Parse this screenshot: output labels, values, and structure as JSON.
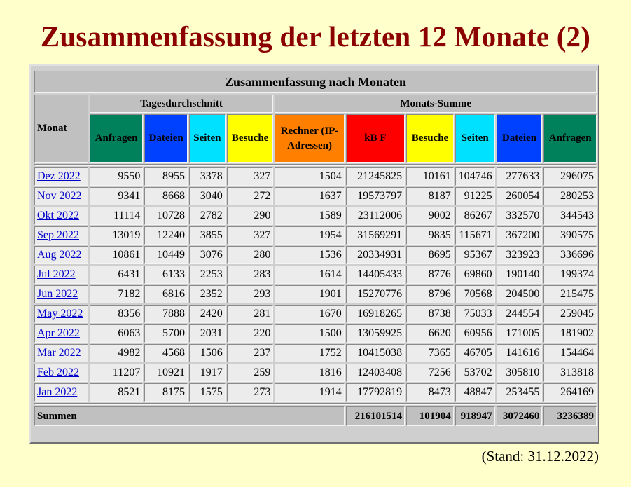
{
  "page_title": "Zusammenfassung der letzten 12 Monate (2)",
  "table": {
    "caption": "Zusammenfassung nach Monaten",
    "group_daily": "Tagesdurchschnitt",
    "group_monthly": "Monats-Summe",
    "month_header": "Monat",
    "daily_columns": [
      {
        "label": "Anfragen",
        "color": "#00805b"
      },
      {
        "label": "Dateien",
        "color": "#0040ff"
      },
      {
        "label": "Seiten",
        "color": "#00e0ff"
      },
      {
        "label": "Besuche",
        "color": "#ffff00"
      }
    ],
    "monthly_columns": [
      {
        "label": "Rechner (IP-Adressen)",
        "color": "#ff8000"
      },
      {
        "label": "kB F",
        "color": "#ff0000"
      },
      {
        "label": "Besuche",
        "color": "#ffff00"
      },
      {
        "label": "Seiten",
        "color": "#00e0ff"
      },
      {
        "label": "Dateien",
        "color": "#0040ff"
      },
      {
        "label": "Anfragen",
        "color": "#00805b"
      }
    ],
    "rows": [
      {
        "month": "Dez 2022",
        "values": [
          "9550",
          "8955",
          "3378",
          "327",
          "1504",
          "21245825",
          "10161",
          "104746",
          "277633",
          "296075"
        ]
      },
      {
        "month": "Nov 2022",
        "values": [
          "9341",
          "8668",
          "3040",
          "272",
          "1637",
          "19573797",
          "8187",
          "91225",
          "260054",
          "280253"
        ]
      },
      {
        "month": "Okt 2022",
        "values": [
          "11114",
          "10728",
          "2782",
          "290",
          "1589",
          "23112006",
          "9002",
          "86267",
          "332570",
          "344543"
        ]
      },
      {
        "month": "Sep 2022",
        "values": [
          "13019",
          "12240",
          "3855",
          "327",
          "1954",
          "31569291",
          "9835",
          "115671",
          "367200",
          "390575"
        ]
      },
      {
        "month": "Aug 2022",
        "values": [
          "10861",
          "10449",
          "3076",
          "280",
          "1536",
          "20334931",
          "8695",
          "95367",
          "323923",
          "336696"
        ]
      },
      {
        "month": "Jul 2022",
        "values": [
          "6431",
          "6133",
          "2253",
          "283",
          "1614",
          "14405433",
          "8776",
          "69860",
          "190140",
          "199374"
        ]
      },
      {
        "month": "Jun 2022",
        "values": [
          "7182",
          "6816",
          "2352",
          "293",
          "1901",
          "15270776",
          "8796",
          "70568",
          "204500",
          "215475"
        ]
      },
      {
        "month": "May 2022",
        "values": [
          "8356",
          "7888",
          "2420",
          "281",
          "1670",
          "16918265",
          "8738",
          "75033",
          "244554",
          "259045"
        ]
      },
      {
        "month": "Apr 2022",
        "values": [
          "6063",
          "5700",
          "2031",
          "220",
          "1500",
          "13059925",
          "6620",
          "60956",
          "171005",
          "181902"
        ]
      },
      {
        "month": "Mar 2022",
        "values": [
          "4982",
          "4568",
          "1506",
          "237",
          "1752",
          "10415038",
          "7365",
          "46705",
          "141616",
          "154464"
        ]
      },
      {
        "month": "Feb 2022",
        "values": [
          "11207",
          "10921",
          "1917",
          "259",
          "1816",
          "12403408",
          "7256",
          "53702",
          "305810",
          "313818"
        ]
      },
      {
        "month": "Jan 2022",
        "values": [
          "8521",
          "8175",
          "1575",
          "273",
          "1914",
          "17792819",
          "8473",
          "48847",
          "253455",
          "264169"
        ]
      }
    ],
    "totals": {
      "label": "Summen",
      "values": [
        "216101514",
        "101904",
        "918947",
        "3072460",
        "3236389"
      ]
    }
  },
  "footer_note": "(Stand: 31.12.2022)"
}
